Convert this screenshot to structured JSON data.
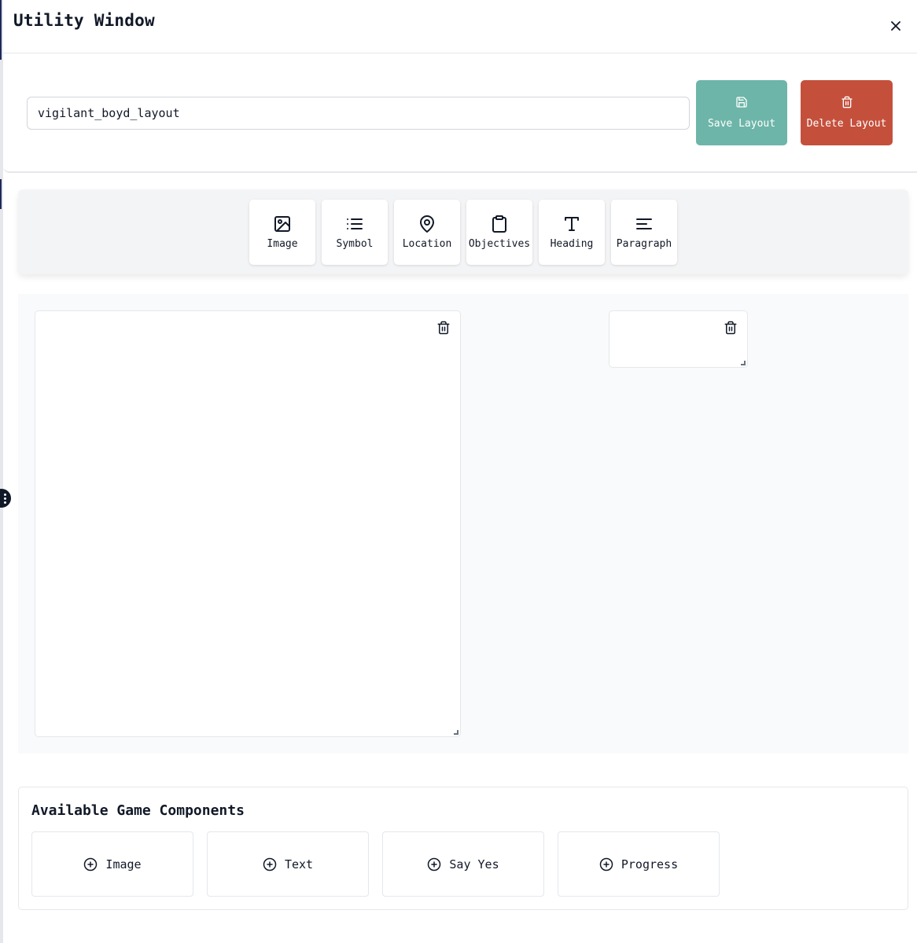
{
  "window": {
    "title": "Utility Window"
  },
  "layout": {
    "name_value": "vigilant_boyd_layout",
    "save_label": "Save Layout",
    "delete_label": "Delete Layout",
    "save_color": "#6db5a8",
    "delete_color": "#c4503c"
  },
  "toolbar": {
    "items": [
      {
        "label": "Image",
        "icon": "image-icon"
      },
      {
        "label": "Symbol",
        "icon": "list-icon"
      },
      {
        "label": "Location",
        "icon": "map-pin-icon"
      },
      {
        "label": "Objectives",
        "icon": "clipboard-icon"
      },
      {
        "label": "Heading",
        "icon": "type-icon"
      },
      {
        "label": "Paragraph",
        "icon": "align-left-icon"
      }
    ]
  },
  "components": {
    "title": "Available Game Components",
    "items": [
      {
        "label": "Image",
        "icon": "plus-circle-icon"
      },
      {
        "label": "Text",
        "icon": "plus-circle-icon"
      },
      {
        "label": "Say Yes",
        "icon": "plus-circle-icon"
      },
      {
        "label": "Progress",
        "icon": "plus-circle-icon"
      }
    ]
  }
}
